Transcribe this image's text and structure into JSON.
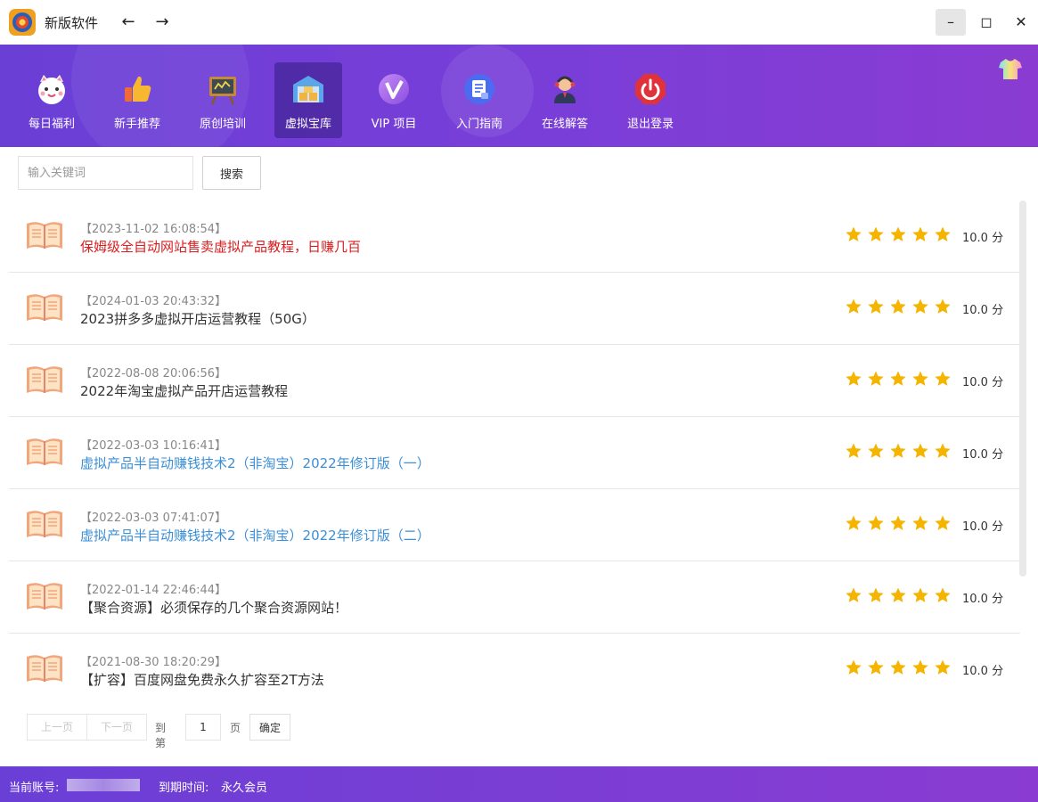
{
  "app": {
    "title": "新版软件"
  },
  "window": {
    "back_icon": "arrow-left-icon",
    "forward_icon": "arrow-right-icon"
  },
  "nav": [
    {
      "label": "每日福利",
      "icon": "lucky-cat-icon",
      "active": false
    },
    {
      "label": "新手推荐",
      "icon": "thumbs-up-icon",
      "active": false
    },
    {
      "label": "原创培训",
      "icon": "blackboard-icon",
      "active": false
    },
    {
      "label": "虚拟宝库",
      "icon": "warehouse-icon",
      "active": true
    },
    {
      "label": "VIP 项目",
      "icon": "vip-icon",
      "active": false
    },
    {
      "label": "入门指南",
      "icon": "document-icon",
      "active": false
    },
    {
      "label": "在线解答",
      "icon": "support-agent-icon",
      "active": false
    },
    {
      "label": "退出登录",
      "icon": "power-icon",
      "active": false
    }
  ],
  "search": {
    "placeholder": "输入关键词",
    "button": "搜索"
  },
  "items": [
    {
      "date": "【2023-11-02 16:08:54】",
      "title": "保姆级全自动网站售卖虚拟产品教程，日赚几百",
      "style": "hot",
      "rating": 5,
      "score": "10.0 分"
    },
    {
      "date": "【2024-01-03 20:43:32】",
      "title": "2023拼多多虚拟开店运营教程（50G）",
      "style": "normal",
      "rating": 5,
      "score": "10.0 分"
    },
    {
      "date": "【2022-08-08 20:06:56】",
      "title": "2022年淘宝虚拟产品开店运营教程",
      "style": "normal",
      "rating": 5,
      "score": "10.0 分"
    },
    {
      "date": "【2022-03-03 10:16:41】",
      "title": "虚拟产品半自动赚钱技术2（非淘宝）2022年修订版（一）",
      "style": "link",
      "rating": 5,
      "score": "10.0 分"
    },
    {
      "date": "【2022-03-03 07:41:07】",
      "title": "虚拟产品半自动赚钱技术2（非淘宝）2022年修订版（二）",
      "style": "link",
      "rating": 5,
      "score": "10.0 分"
    },
    {
      "date": "【2022-01-14 22:46:44】",
      "title": "【聚合资源】必须保存的几个聚合资源网站！",
      "style": "normal",
      "rating": 5,
      "score": "10.0 分"
    },
    {
      "date": "【2021-08-30 18:20:29】",
      "title": "【扩容】百度网盘免费永久扩容至2T方法",
      "style": "normal",
      "rating": 5,
      "score": "10.0 分"
    }
  ],
  "pager": {
    "prev": "上一页",
    "next": "下一页",
    "goto_label": "到第",
    "page_value": "1",
    "page_unit": "页",
    "confirm": "确定"
  },
  "status": {
    "account_label": "当前账号:",
    "expiry_label": "到期时间:",
    "expiry_value": "永久会员"
  },
  "colors": {
    "accent": "#7040d6",
    "hot": "#d81e1e",
    "link": "#3b8fd6",
    "star": "#f5b400"
  }
}
